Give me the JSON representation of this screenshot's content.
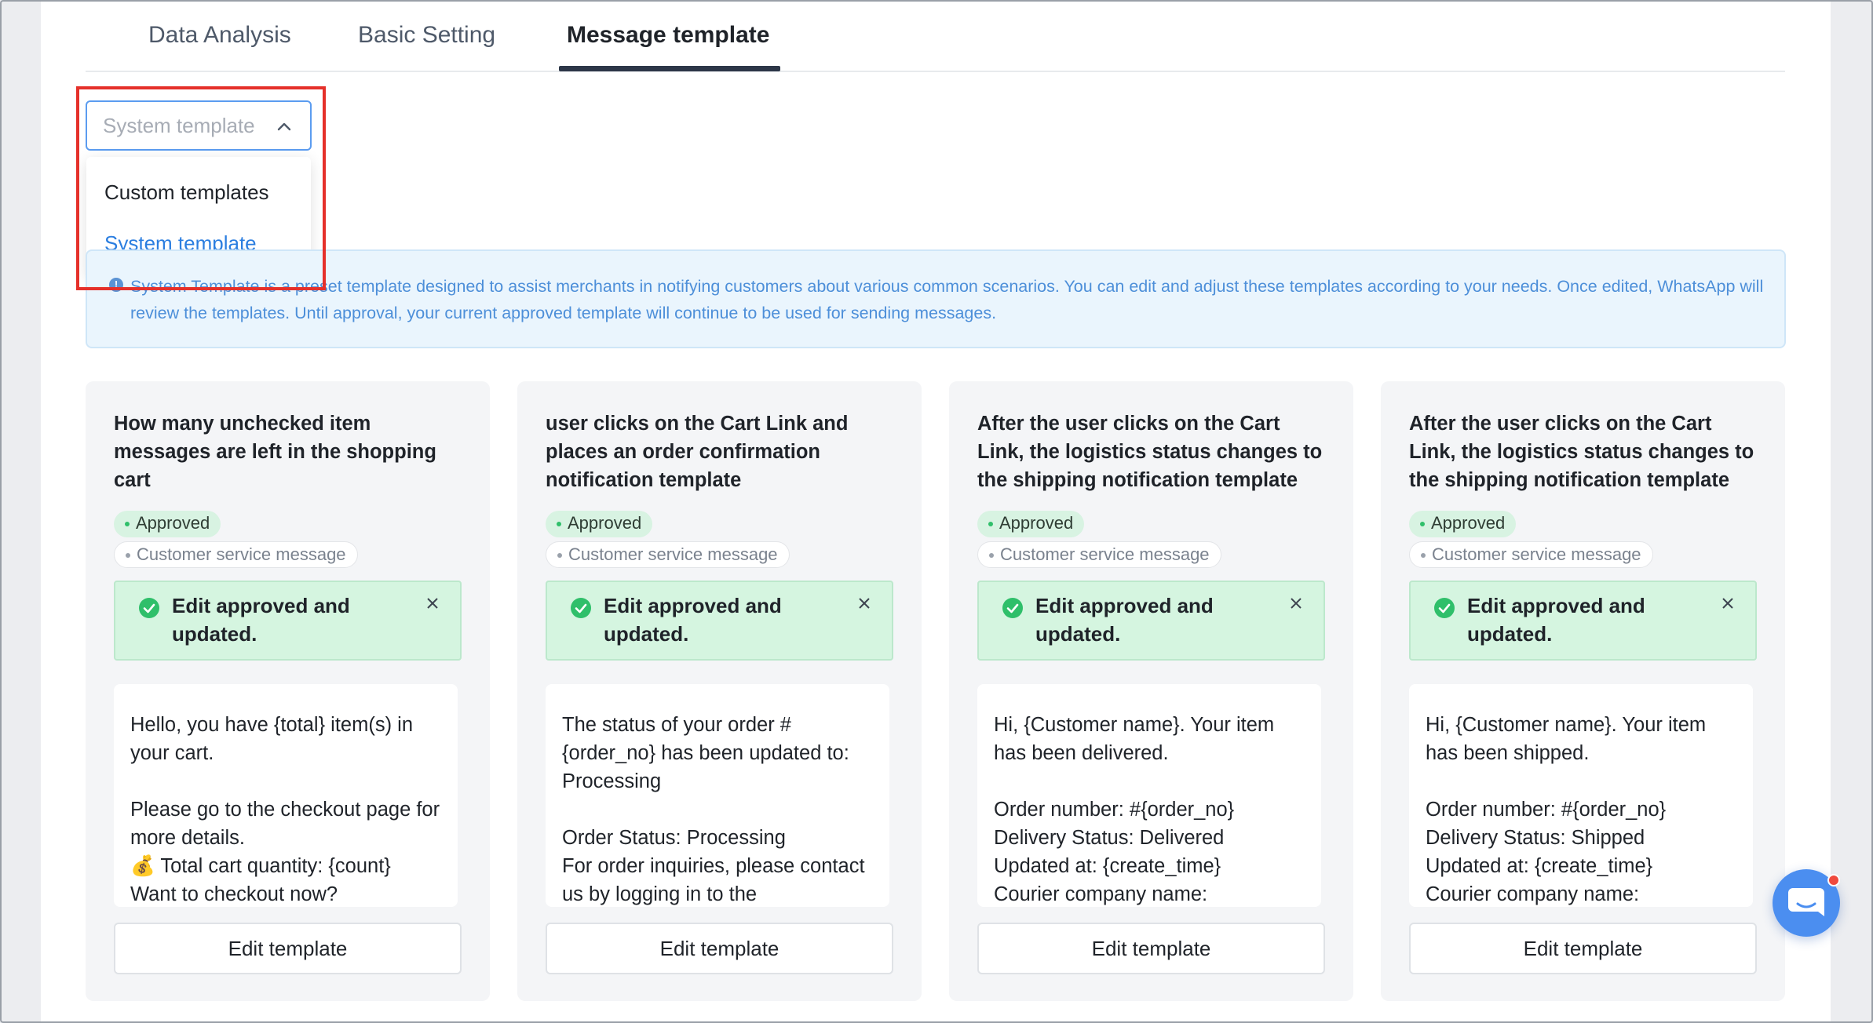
{
  "tabs": [
    {
      "label": "Data Analysis",
      "active": false
    },
    {
      "label": "Basic Setting",
      "active": false
    },
    {
      "label": "Message template",
      "active": true
    }
  ],
  "template_select": {
    "value": "System template",
    "options": [
      "Custom templates",
      "System template"
    ],
    "selected_color": "#2b7ee0"
  },
  "info_banner": {
    "icon": "info-icon",
    "text": "System Template is a preset template designed to assist merchants in notifying customers about various common scenarios. You can edit and adjust these templates according to your needs. Once edited, WhatsApp will review the templates. Until approval, your current approved template will continue to be used for sending messages."
  },
  "cards": [
    {
      "title": "How many unchecked item messages are left in the shopping cart",
      "status_tag": "Approved",
      "type_tag": "Customer service message",
      "alert": "Edit approved and updated.",
      "body": "Hello, you have {total} item(s) in your cart.\n\nPlease go to the checkout page for more details.\n💰 Total cart quantity: {count}\nWant to checkout now?",
      "button": "Edit template"
    },
    {
      "title": "user clicks on the Cart Link and places an order confirmation notification template",
      "status_tag": "Approved",
      "type_tag": "Customer service message",
      "alert": "Edit approved and updated.",
      "body": "The status of your order #{order_no} has been updated to: Processing\n\nOrder Status: Processing\nFor order inquiries, please contact us by logging in to the",
      "button": "Edit template"
    },
    {
      "title": "After the user clicks on the Cart Link, the logistics status changes to the shipping notification template",
      "status_tag": "Approved",
      "type_tag": "Customer service message",
      "alert": "Edit approved and updated.",
      "body": "Hi, {Customer name}. Your item has been delivered.\n\nOrder number: #{order_no}\nDelivery Status: Delivered\nUpdated at: {create_time}\nCourier company name:",
      "button": "Edit template"
    },
    {
      "title": "After the user clicks on the Cart Link, the logistics status changes to the shipping notification template",
      "status_tag": "Approved",
      "type_tag": "Customer service message",
      "alert": "Edit approved and updated.",
      "body": "Hi, {Customer name}. Your item has been shipped.\n\nOrder number: #{order_no}\nDelivery Status: Shipped\nUpdated at: {create_time}\nCourier company name:",
      "button": "Edit template"
    }
  ],
  "icons": {
    "select": "chevron-up-icon",
    "alert": "check-circle-icon",
    "close": "close-icon",
    "chat": "chat-bubble-icon"
  },
  "colors": {
    "accent": "#4b8ef0",
    "success": "#2fbf6a",
    "highlight_box": "#e5302a"
  }
}
